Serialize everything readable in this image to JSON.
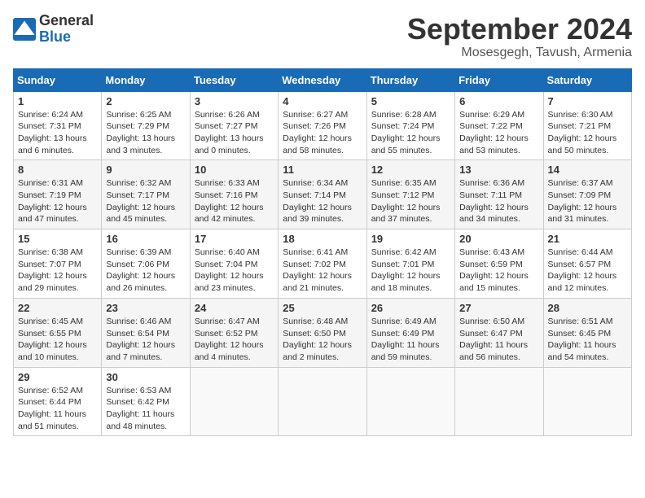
{
  "logo": {
    "line1": "General",
    "line2": "Blue"
  },
  "title": "September 2024",
  "location": "Mosesgegh, Tavush, Armenia",
  "days_of_week": [
    "Sunday",
    "Monday",
    "Tuesday",
    "Wednesday",
    "Thursday",
    "Friday",
    "Saturday"
  ],
  "weeks": [
    [
      {
        "day": 1,
        "info": "Sunrise: 6:24 AM\nSunset: 7:31 PM\nDaylight: 13 hours\nand 6 minutes."
      },
      {
        "day": 2,
        "info": "Sunrise: 6:25 AM\nSunset: 7:29 PM\nDaylight: 13 hours\nand 3 minutes."
      },
      {
        "day": 3,
        "info": "Sunrise: 6:26 AM\nSunset: 7:27 PM\nDaylight: 13 hours\nand 0 minutes."
      },
      {
        "day": 4,
        "info": "Sunrise: 6:27 AM\nSunset: 7:26 PM\nDaylight: 12 hours\nand 58 minutes."
      },
      {
        "day": 5,
        "info": "Sunrise: 6:28 AM\nSunset: 7:24 PM\nDaylight: 12 hours\nand 55 minutes."
      },
      {
        "day": 6,
        "info": "Sunrise: 6:29 AM\nSunset: 7:22 PM\nDaylight: 12 hours\nand 53 minutes."
      },
      {
        "day": 7,
        "info": "Sunrise: 6:30 AM\nSunset: 7:21 PM\nDaylight: 12 hours\nand 50 minutes."
      }
    ],
    [
      {
        "day": 8,
        "info": "Sunrise: 6:31 AM\nSunset: 7:19 PM\nDaylight: 12 hours\nand 47 minutes."
      },
      {
        "day": 9,
        "info": "Sunrise: 6:32 AM\nSunset: 7:17 PM\nDaylight: 12 hours\nand 45 minutes."
      },
      {
        "day": 10,
        "info": "Sunrise: 6:33 AM\nSunset: 7:16 PM\nDaylight: 12 hours\nand 42 minutes."
      },
      {
        "day": 11,
        "info": "Sunrise: 6:34 AM\nSunset: 7:14 PM\nDaylight: 12 hours\nand 39 minutes."
      },
      {
        "day": 12,
        "info": "Sunrise: 6:35 AM\nSunset: 7:12 PM\nDaylight: 12 hours\nand 37 minutes."
      },
      {
        "day": 13,
        "info": "Sunrise: 6:36 AM\nSunset: 7:11 PM\nDaylight: 12 hours\nand 34 minutes."
      },
      {
        "day": 14,
        "info": "Sunrise: 6:37 AM\nSunset: 7:09 PM\nDaylight: 12 hours\nand 31 minutes."
      }
    ],
    [
      {
        "day": 15,
        "info": "Sunrise: 6:38 AM\nSunset: 7:07 PM\nDaylight: 12 hours\nand 29 minutes."
      },
      {
        "day": 16,
        "info": "Sunrise: 6:39 AM\nSunset: 7:06 PM\nDaylight: 12 hours\nand 26 minutes."
      },
      {
        "day": 17,
        "info": "Sunrise: 6:40 AM\nSunset: 7:04 PM\nDaylight: 12 hours\nand 23 minutes."
      },
      {
        "day": 18,
        "info": "Sunrise: 6:41 AM\nSunset: 7:02 PM\nDaylight: 12 hours\nand 21 minutes."
      },
      {
        "day": 19,
        "info": "Sunrise: 6:42 AM\nSunset: 7:01 PM\nDaylight: 12 hours\nand 18 minutes."
      },
      {
        "day": 20,
        "info": "Sunrise: 6:43 AM\nSunset: 6:59 PM\nDaylight: 12 hours\nand 15 minutes."
      },
      {
        "day": 21,
        "info": "Sunrise: 6:44 AM\nSunset: 6:57 PM\nDaylight: 12 hours\nand 12 minutes."
      }
    ],
    [
      {
        "day": 22,
        "info": "Sunrise: 6:45 AM\nSunset: 6:55 PM\nDaylight: 12 hours\nand 10 minutes."
      },
      {
        "day": 23,
        "info": "Sunrise: 6:46 AM\nSunset: 6:54 PM\nDaylight: 12 hours\nand 7 minutes."
      },
      {
        "day": 24,
        "info": "Sunrise: 6:47 AM\nSunset: 6:52 PM\nDaylight: 12 hours\nand 4 minutes."
      },
      {
        "day": 25,
        "info": "Sunrise: 6:48 AM\nSunset: 6:50 PM\nDaylight: 12 hours\nand 2 minutes."
      },
      {
        "day": 26,
        "info": "Sunrise: 6:49 AM\nSunset: 6:49 PM\nDaylight: 11 hours\nand 59 minutes."
      },
      {
        "day": 27,
        "info": "Sunrise: 6:50 AM\nSunset: 6:47 PM\nDaylight: 11 hours\nand 56 minutes."
      },
      {
        "day": 28,
        "info": "Sunrise: 6:51 AM\nSunset: 6:45 PM\nDaylight: 11 hours\nand 54 minutes."
      }
    ],
    [
      {
        "day": 29,
        "info": "Sunrise: 6:52 AM\nSunset: 6:44 PM\nDaylight: 11 hours\nand 51 minutes."
      },
      {
        "day": 30,
        "info": "Sunrise: 6:53 AM\nSunset: 6:42 PM\nDaylight: 11 hours\nand 48 minutes."
      },
      null,
      null,
      null,
      null,
      null
    ]
  ]
}
